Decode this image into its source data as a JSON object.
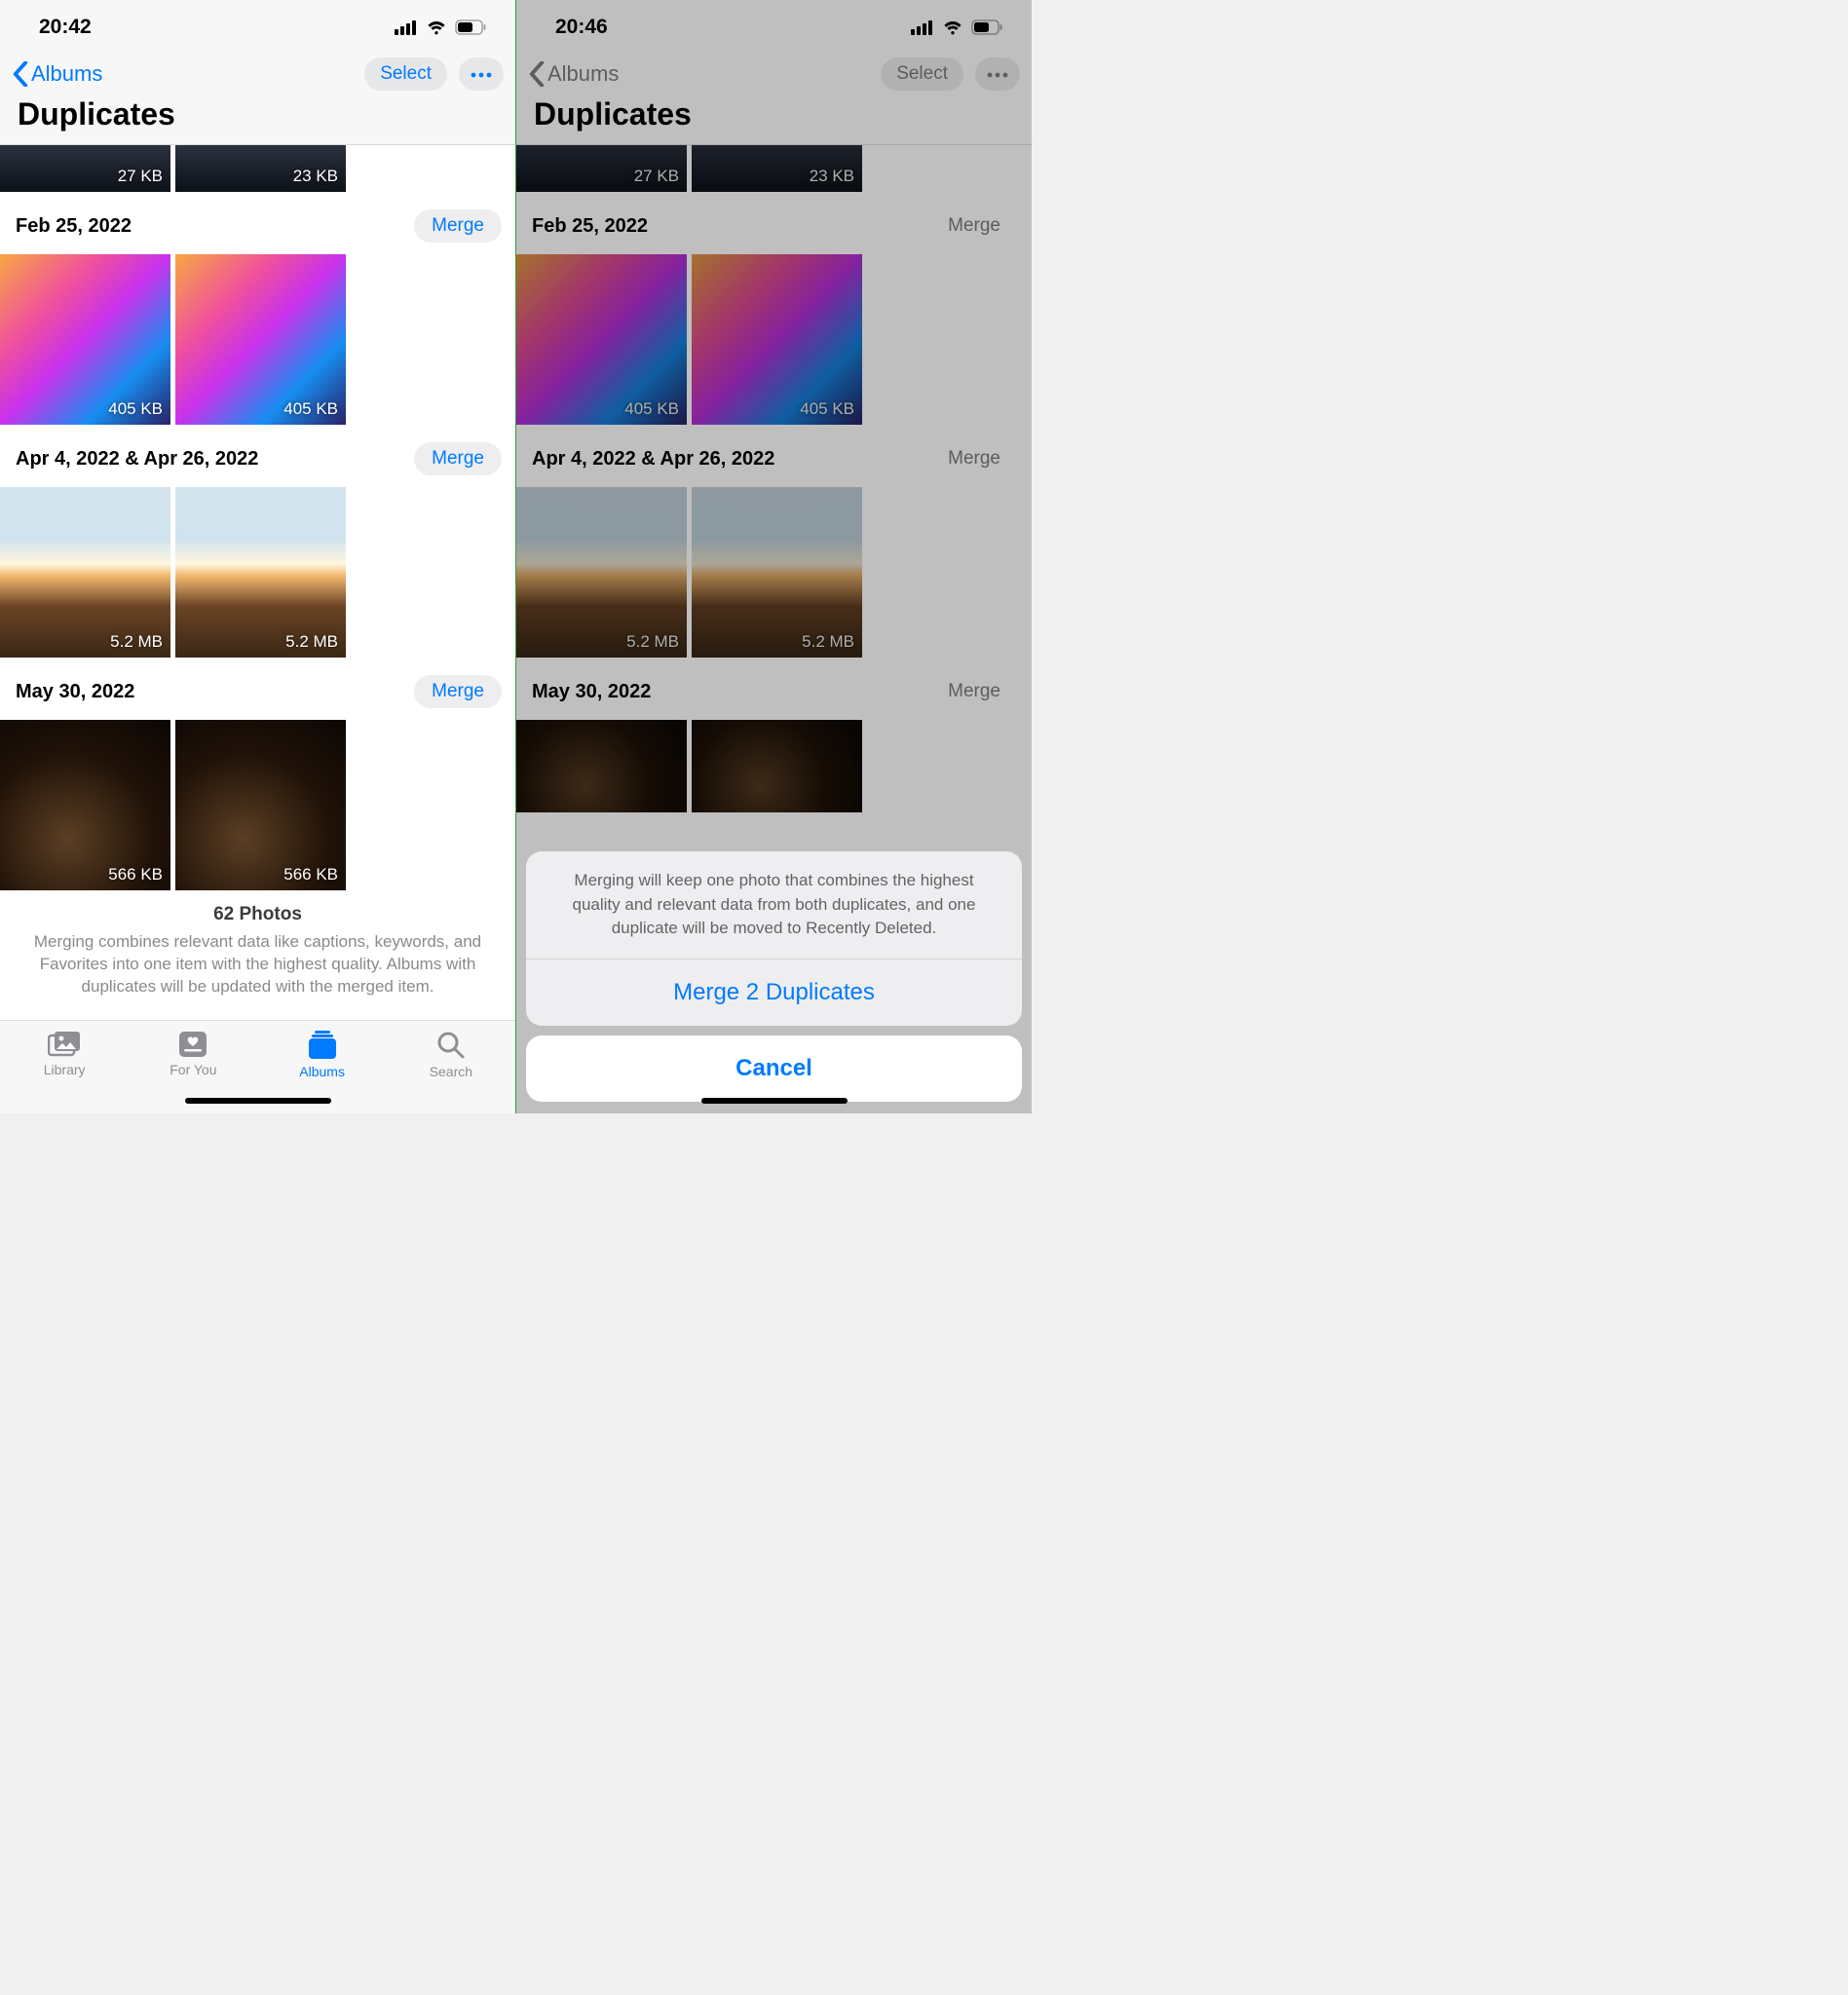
{
  "left": {
    "status": {
      "time": "20:42"
    },
    "nav": {
      "back_label": "Albums",
      "select_label": "Select"
    },
    "title": "Duplicates",
    "strip_sizes": [
      "27 KB",
      "23 KB"
    ],
    "groups": [
      {
        "date": "Feb 25, 2022",
        "merge": "Merge",
        "sizes": [
          "405 KB",
          "405 KB"
        ],
        "kind": "wallpaper"
      },
      {
        "date": "Apr 4, 2022 & Apr 26, 2022",
        "merge": "Merge",
        "sizes": [
          "5.2 MB",
          "5.2 MB"
        ],
        "kind": "sunset"
      },
      {
        "date": "May 30, 2022",
        "merge": "Merge",
        "sizes": [
          "566 KB",
          "566 KB"
        ],
        "kind": "dark"
      }
    ],
    "summary": {
      "count": "62 Photos",
      "body": "Merging combines relevant data like captions, keywords, and Favorites into one item with the highest quality. Albums with duplicates will be updated with the merged item."
    },
    "tabs": {
      "library": "Library",
      "foryou": "For You",
      "albums": "Albums",
      "search": "Search"
    }
  },
  "right": {
    "status": {
      "time": "20:46"
    },
    "nav": {
      "back_label": "Albums",
      "select_label": "Select"
    },
    "title": "Duplicates",
    "strip_sizes": [
      "27 KB",
      "23 KB"
    ],
    "groups": [
      {
        "date": "Feb 25, 2022",
        "merge": "Merge",
        "sizes": [
          "405 KB",
          "405 KB"
        ],
        "kind": "wallpaper"
      },
      {
        "date": "Apr 4, 2022 & Apr 26, 2022",
        "merge": "Merge",
        "sizes": [
          "5.2 MB",
          "5.2 MB"
        ],
        "kind": "sunset"
      },
      {
        "date": "May 30, 2022",
        "merge": "Merge",
        "sizes": [],
        "kind": "dark"
      }
    ],
    "sheet": {
      "message": "Merging will keep one photo that combines the highest quality and relevant data from both duplicates, and one duplicate will be moved to Recently Deleted.",
      "action": "Merge 2 Duplicates",
      "cancel": "Cancel"
    }
  }
}
